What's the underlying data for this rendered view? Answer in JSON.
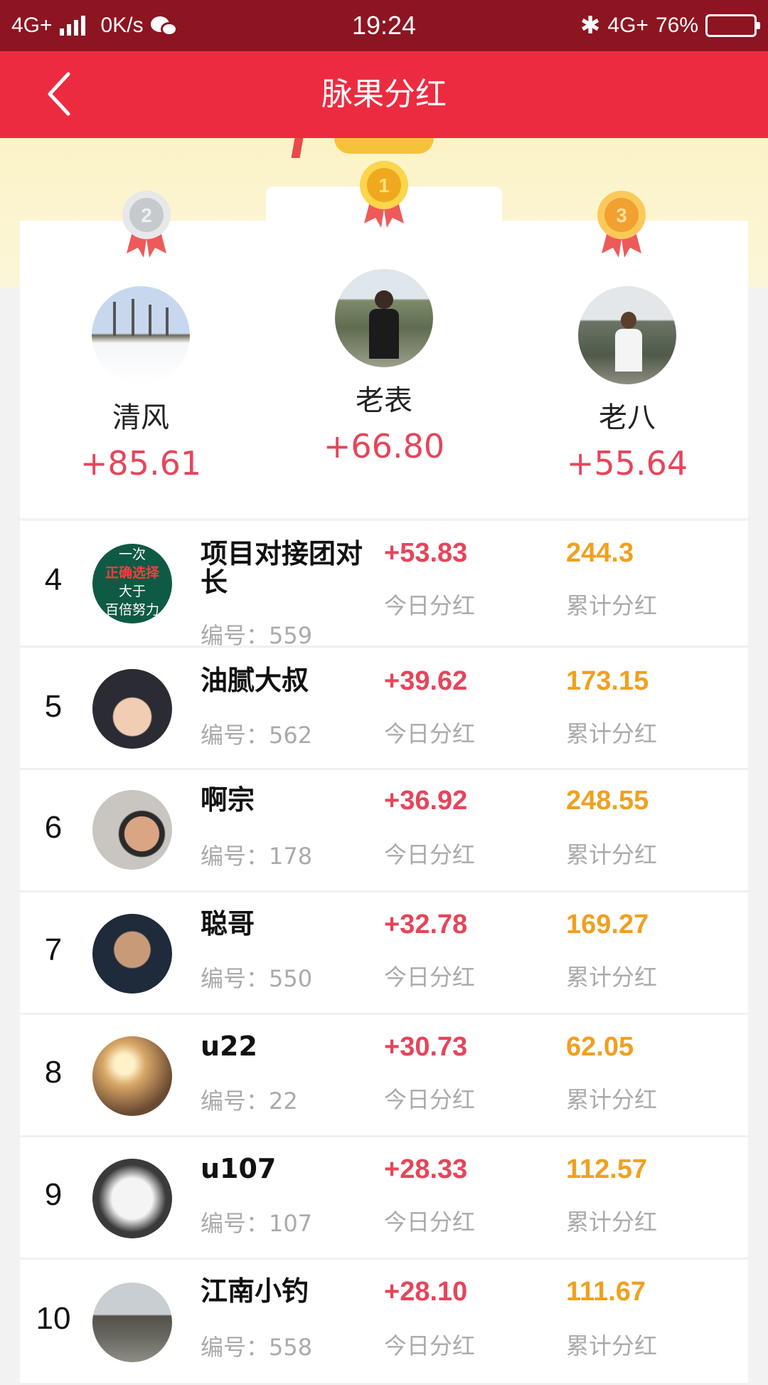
{
  "status_bar": {
    "network_left": "4G+",
    "speed": "0K/s",
    "time": "19:24",
    "network_right": "4G+",
    "battery": "76%",
    "battery_level": 0.76
  },
  "nav": {
    "title": "脉果分红"
  },
  "podium": [
    {
      "place": 2,
      "name": "清风",
      "amount": "+85.61",
      "medal_color": "#c9ccd1"
    },
    {
      "place": 1,
      "name": "老表",
      "amount": "+66.80",
      "medal_color": "#f3b928"
    },
    {
      "place": 3,
      "name": "老八",
      "amount": "+55.64",
      "medal_color": "#f5a23a"
    }
  ],
  "labels": {
    "today": "今日分红",
    "total": "累计分红",
    "id_prefix": "编号："
  },
  "ranking": [
    {
      "rank": "4",
      "name": "项目对接团对长",
      "id": "559",
      "today": "+53.83",
      "total": "244.3"
    },
    {
      "rank": "5",
      "name": "油腻大叔",
      "id": "562",
      "today": "+39.62",
      "total": "173.15"
    },
    {
      "rank": "6",
      "name": "啊宗",
      "id": "178",
      "today": "+36.92",
      "total": "248.55"
    },
    {
      "rank": "7",
      "name": "聪哥",
      "id": "550",
      "today": "+32.78",
      "total": "169.27"
    },
    {
      "rank": "8",
      "name": "u22",
      "id": "22",
      "today": "+30.73",
      "total": "62.05"
    },
    {
      "rank": "9",
      "name": "u107",
      "id": "107",
      "today": "+28.33",
      "total": "112.57"
    },
    {
      "rank": "10",
      "name": "江南小钓",
      "id": "558",
      "today": "+28.10",
      "total": "111.67"
    }
  ],
  "avatar_text": {
    "row4": [
      "一次",
      "正确选择",
      "大于",
      "百倍努力"
    ]
  }
}
